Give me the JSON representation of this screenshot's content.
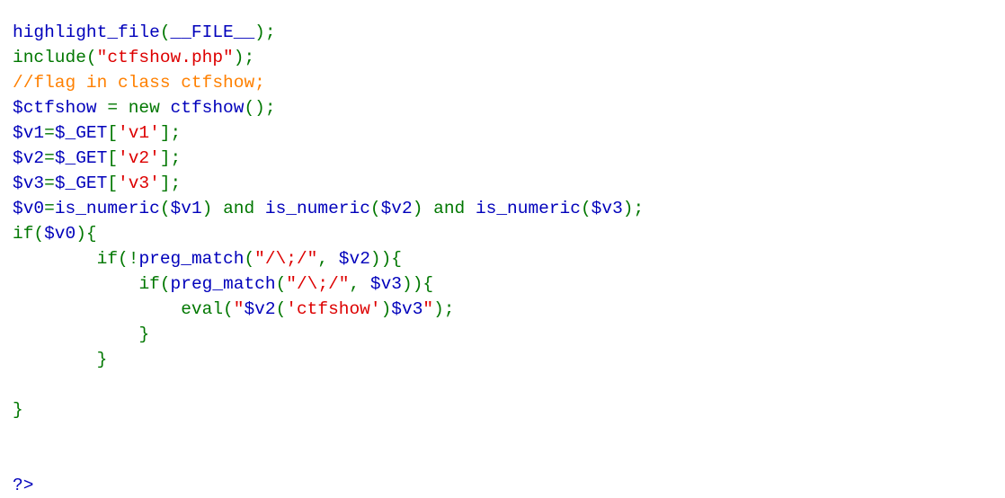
{
  "page": {
    "title": "PHP Source Highlight",
    "background_color": "#ffffff",
    "language": "php",
    "renderer": "highlight_file"
  },
  "colors": {
    "default": "#0000BB",
    "keyword": "#007700",
    "string": "#DD0000",
    "comment": "#FF8000",
    "html": "#000000",
    "background": "#ffffff"
  },
  "code": {
    "lines": [
      {
        "index": 1,
        "text": "highlight_file(__FILE__);",
        "tokens": [
          {
            "t": "highlight_file",
            "c": "default"
          },
          {
            "t": "(",
            "c": "keyword"
          },
          {
            "t": "__FILE__",
            "c": "default"
          },
          {
            "t": ");",
            "c": "keyword"
          }
        ]
      },
      {
        "index": 2,
        "text": "include(\"ctfshow.php\");",
        "tokens": [
          {
            "t": "include",
            "c": "keyword"
          },
          {
            "t": "(",
            "c": "keyword"
          },
          {
            "t": "\"ctfshow.php\"",
            "c": "string"
          },
          {
            "t": ");",
            "c": "keyword"
          }
        ]
      },
      {
        "index": 3,
        "text": "//flag in class ctfshow;",
        "tokens": [
          {
            "t": "//flag in class ctfshow;",
            "c": "comment"
          }
        ]
      },
      {
        "index": 4,
        "text": "$ctfshow = new ctfshow();",
        "tokens": [
          {
            "t": "$ctfshow",
            "c": "default"
          },
          {
            "t": " = ",
            "c": "keyword"
          },
          {
            "t": "new",
            "c": "keyword"
          },
          {
            "t": " ",
            "c": "keyword"
          },
          {
            "t": "ctfshow",
            "c": "default"
          },
          {
            "t": "();",
            "c": "keyword"
          }
        ]
      },
      {
        "index": 5,
        "text": "$v1=$_GET['v1'];",
        "tokens": [
          {
            "t": "$v1",
            "c": "default"
          },
          {
            "t": "=",
            "c": "keyword"
          },
          {
            "t": "$_GET",
            "c": "default"
          },
          {
            "t": "[",
            "c": "keyword"
          },
          {
            "t": "'v1'",
            "c": "string"
          },
          {
            "t": "];",
            "c": "keyword"
          }
        ]
      },
      {
        "index": 6,
        "text": "$v2=$_GET['v2'];",
        "tokens": [
          {
            "t": "$v2",
            "c": "default"
          },
          {
            "t": "=",
            "c": "keyword"
          },
          {
            "t": "$_GET",
            "c": "default"
          },
          {
            "t": "[",
            "c": "keyword"
          },
          {
            "t": "'v2'",
            "c": "string"
          },
          {
            "t": "];",
            "c": "keyword"
          }
        ]
      },
      {
        "index": 7,
        "text": "$v3=$_GET['v3'];",
        "tokens": [
          {
            "t": "$v3",
            "c": "default"
          },
          {
            "t": "=",
            "c": "keyword"
          },
          {
            "t": "$_GET",
            "c": "default"
          },
          {
            "t": "[",
            "c": "keyword"
          },
          {
            "t": "'v3'",
            "c": "string"
          },
          {
            "t": "];",
            "c": "keyword"
          }
        ]
      },
      {
        "index": 8,
        "text": "$v0=is_numeric($v1) and is_numeric($v2) and is_numeric($v3);",
        "tokens": [
          {
            "t": "$v0",
            "c": "default"
          },
          {
            "t": "=",
            "c": "keyword"
          },
          {
            "t": "is_numeric",
            "c": "default"
          },
          {
            "t": "(",
            "c": "keyword"
          },
          {
            "t": "$v1",
            "c": "default"
          },
          {
            "t": ") ",
            "c": "keyword"
          },
          {
            "t": "and",
            "c": "keyword"
          },
          {
            "t": " ",
            "c": "keyword"
          },
          {
            "t": "is_numeric",
            "c": "default"
          },
          {
            "t": "(",
            "c": "keyword"
          },
          {
            "t": "$v2",
            "c": "default"
          },
          {
            "t": ") ",
            "c": "keyword"
          },
          {
            "t": "and",
            "c": "keyword"
          },
          {
            "t": " ",
            "c": "keyword"
          },
          {
            "t": "is_numeric",
            "c": "default"
          },
          {
            "t": "(",
            "c": "keyword"
          },
          {
            "t": "$v3",
            "c": "default"
          },
          {
            "t": ");",
            "c": "keyword"
          }
        ]
      },
      {
        "index": 9,
        "text": "if($v0){",
        "tokens": [
          {
            "t": "if",
            "c": "keyword"
          },
          {
            "t": "(",
            "c": "keyword"
          },
          {
            "t": "$v0",
            "c": "default"
          },
          {
            "t": "){",
            "c": "keyword"
          }
        ]
      },
      {
        "index": 10,
        "text": "        if(!preg_match(\"/\\;/\", $v2)){",
        "tokens": [
          {
            "t": "        ",
            "c": "keyword"
          },
          {
            "t": "if",
            "c": "keyword"
          },
          {
            "t": "(!",
            "c": "keyword"
          },
          {
            "t": "preg_match",
            "c": "default"
          },
          {
            "t": "(",
            "c": "keyword"
          },
          {
            "t": "\"/\\;/\"",
            "c": "string"
          },
          {
            "t": ", ",
            "c": "keyword"
          },
          {
            "t": "$v2",
            "c": "default"
          },
          {
            "t": ")){",
            "c": "keyword"
          }
        ]
      },
      {
        "index": 11,
        "text": "            if(preg_match(\"/\\;/\", $v3)){",
        "tokens": [
          {
            "t": "            ",
            "c": "keyword"
          },
          {
            "t": "if",
            "c": "keyword"
          },
          {
            "t": "(",
            "c": "keyword"
          },
          {
            "t": "preg_match",
            "c": "default"
          },
          {
            "t": "(",
            "c": "keyword"
          },
          {
            "t": "\"/\\;/\"",
            "c": "string"
          },
          {
            "t": ", ",
            "c": "keyword"
          },
          {
            "t": "$v3",
            "c": "default"
          },
          {
            "t": ")){",
            "c": "keyword"
          }
        ]
      },
      {
        "index": 12,
        "text": "                eval(\"$v2('ctfshow')$v3\");",
        "tokens": [
          {
            "t": "                ",
            "c": "keyword"
          },
          {
            "t": "eval",
            "c": "keyword"
          },
          {
            "t": "(",
            "c": "keyword"
          },
          {
            "t": "\"",
            "c": "string"
          },
          {
            "t": "$v2",
            "c": "default"
          },
          {
            "t": "(",
            "c": "keyword"
          },
          {
            "t": "'ctfshow'",
            "c": "string"
          },
          {
            "t": ")",
            "c": "keyword"
          },
          {
            "t": "$v3",
            "c": "default"
          },
          {
            "t": "\"",
            "c": "string"
          },
          {
            "t": ");",
            "c": "keyword"
          }
        ]
      },
      {
        "index": 13,
        "text": "            }",
        "tokens": [
          {
            "t": "            ",
            "c": "keyword"
          },
          {
            "t": "}",
            "c": "keyword"
          }
        ]
      },
      {
        "index": 14,
        "text": "        }",
        "tokens": [
          {
            "t": "        ",
            "c": "keyword"
          },
          {
            "t": "}",
            "c": "keyword"
          }
        ]
      },
      {
        "index": 15,
        "text": "",
        "tokens": []
      },
      {
        "index": 16,
        "text": "}",
        "tokens": [
          {
            "t": "}",
            "c": "keyword"
          }
        ]
      },
      {
        "index": 17,
        "text": "",
        "tokens": []
      },
      {
        "index": 18,
        "text": "",
        "tokens": []
      },
      {
        "index": 19,
        "text": "?>",
        "tokens": [
          {
            "t": "?>",
            "c": "default"
          }
        ]
      }
    ]
  }
}
